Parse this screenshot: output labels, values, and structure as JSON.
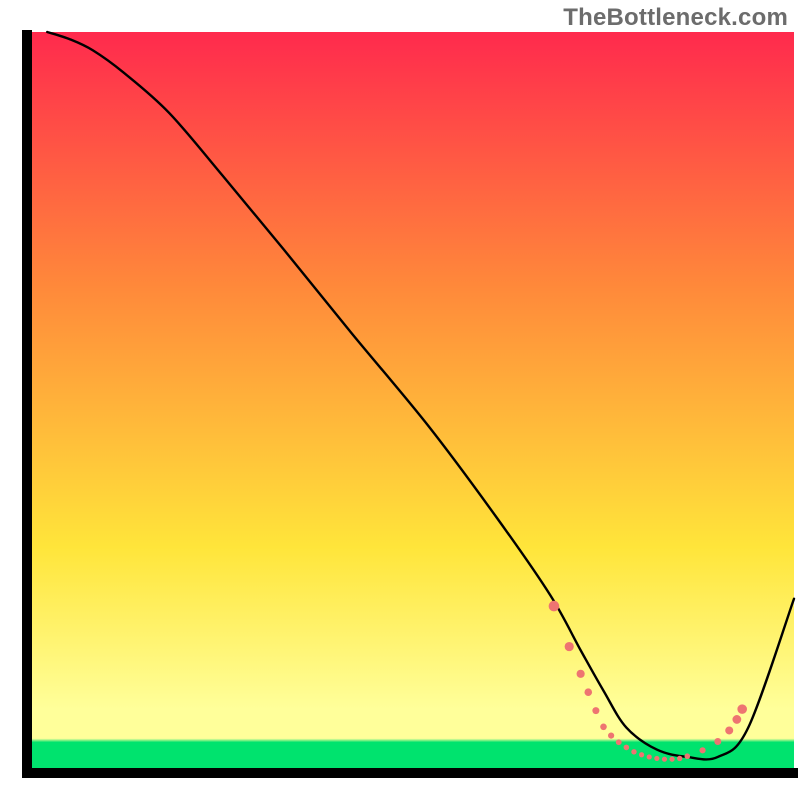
{
  "watermark": "TheBottleneck.com",
  "chart_data": {
    "type": "line",
    "title": "",
    "xlabel": "",
    "ylabel": "",
    "xlim": [
      0,
      100
    ],
    "ylim": [
      0,
      100
    ],
    "background_gradient": {
      "top": "#ff2a4d",
      "mid_upper": "#ff8a3a",
      "mid_lower": "#ffe53a",
      "near_bottom": "#ffff9a",
      "bottom_band": "#00e36e"
    },
    "series": [
      {
        "name": "bottleneck-curve",
        "stroke": "#000000",
        "x": [
          2,
          5,
          8,
          12,
          18,
          25,
          33,
          42,
          52,
          61,
          68,
          72,
          75,
          78,
          82,
          86,
          90,
          94,
          100
        ],
        "y": [
          100,
          99,
          97.5,
          94.5,
          89,
          80.5,
          70.5,
          59,
          46.5,
          34,
          23.5,
          16,
          10.5,
          5.5,
          2.5,
          1.5,
          1.5,
          5.5,
          23
        ]
      }
    ],
    "markers": {
      "name": "highlight-dots",
      "color": "#ee7471",
      "x": [
        68.5,
        70.5,
        72,
        73,
        74,
        75,
        76,
        77,
        78,
        79,
        80,
        81,
        82,
        83,
        84,
        85,
        86,
        88,
        90,
        91.5,
        92.5,
        93.2
      ],
      "y": [
        22,
        16.5,
        12.8,
        10.3,
        7.8,
        5.6,
        4.4,
        3.5,
        2.8,
        2.2,
        1.8,
        1.5,
        1.3,
        1.2,
        1.2,
        1.3,
        1.6,
        2.4,
        3.6,
        5.1,
        6.6,
        8.0
      ],
      "r": [
        5.3,
        4.6,
        4.1,
        3.8,
        3.5,
        3.3,
        3.1,
        2.9,
        2.8,
        2.7,
        2.6,
        2.6,
        2.6,
        2.6,
        2.6,
        2.7,
        2.8,
        3.1,
        3.5,
        4.0,
        4.4,
        4.8
      ]
    }
  }
}
